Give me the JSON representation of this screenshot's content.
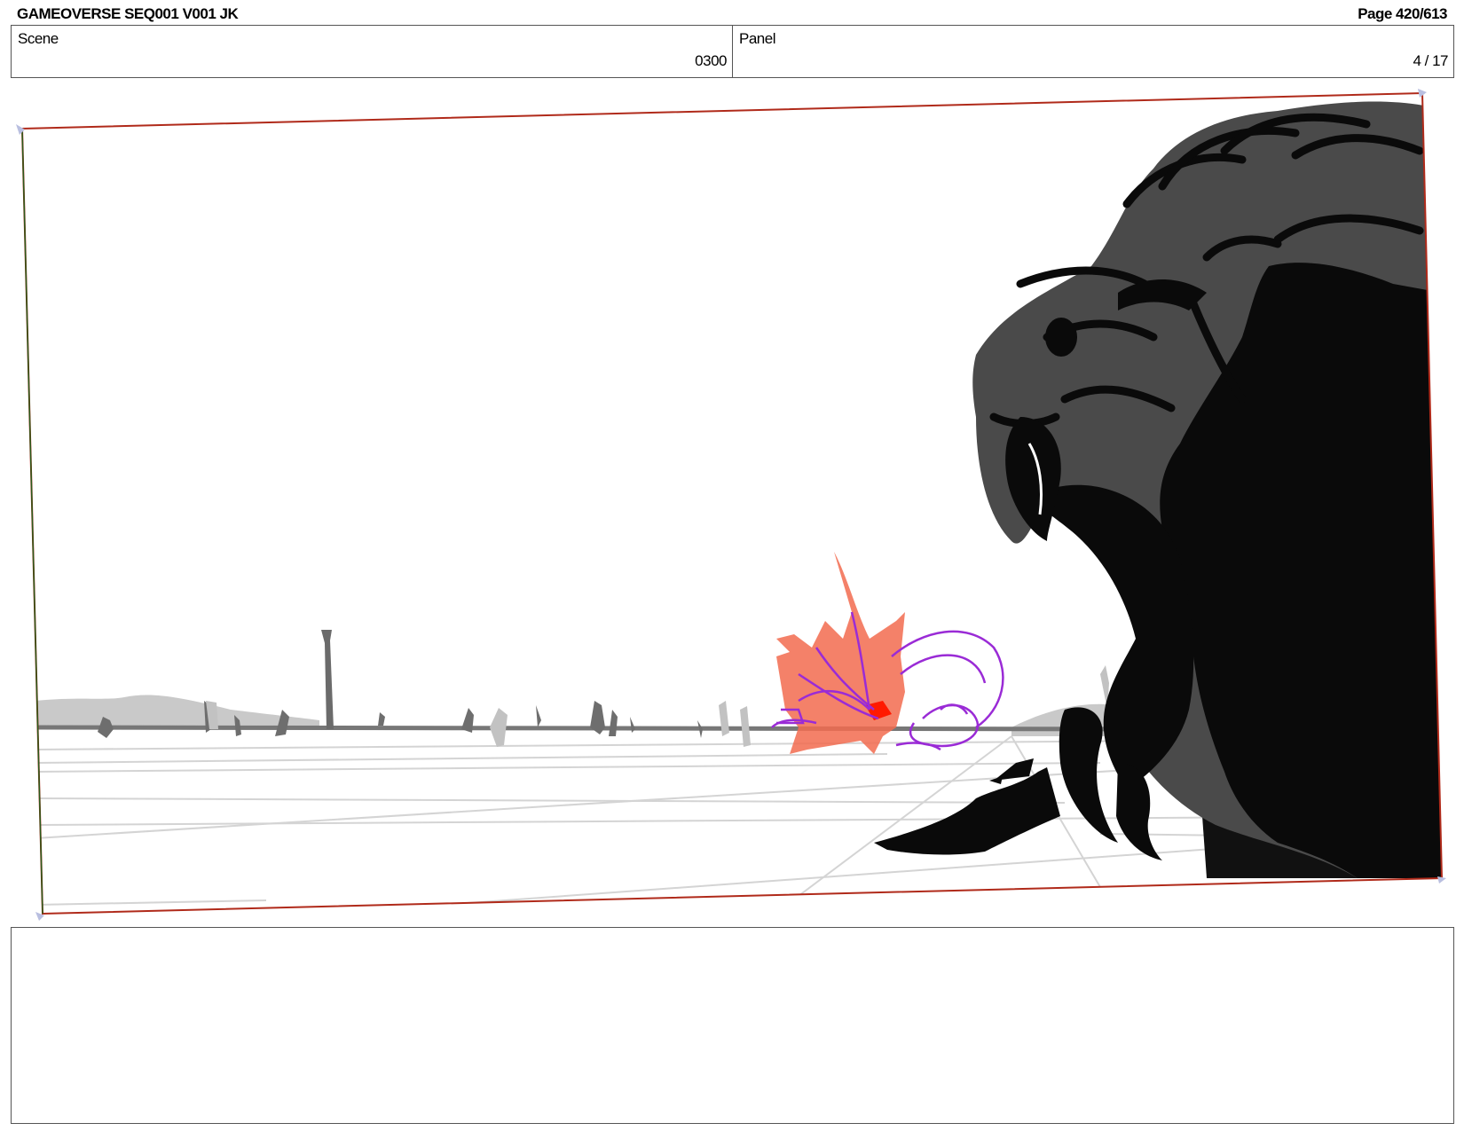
{
  "header": {
    "title": "GAMEOVERSE SEQ001 V001 JK",
    "page": "Page 420/613"
  },
  "scene": {
    "label": "Scene",
    "value": "0300"
  },
  "panel": {
    "label": "Panel",
    "value": "4 / 17"
  },
  "drawing": {
    "frame_color": "#b02a1a",
    "creature_dark": "#0a0a0a",
    "creature_mid": "#4a4a4a",
    "horizon_gray": "#777777",
    "effect_orange": "#f26b4f",
    "effect_purple": "#9a2bd6"
  },
  "notes": {
    "text": ""
  }
}
